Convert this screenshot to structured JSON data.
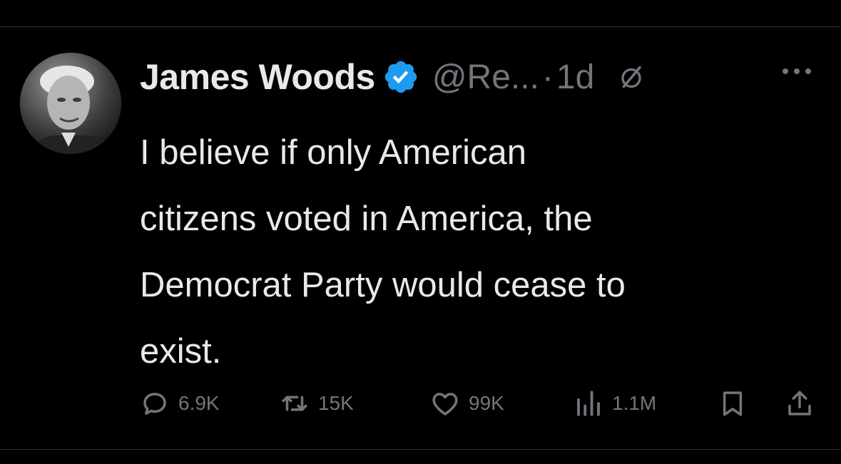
{
  "tweet": {
    "author_name": "James Woods",
    "handle": "@Re...",
    "separator": "·",
    "time": "1d",
    "verified": true,
    "verified_color": "#1d9bf0",
    "text_lines": [
      "I believe if only American",
      "citizens voted in America, the",
      "Democrat Party would cease to",
      "exist."
    ]
  },
  "actions": {
    "replies": "6.9K",
    "retweets": "15K",
    "likes": "99K",
    "views": "1.1M"
  },
  "icons": {
    "verified": "verified-badge-icon",
    "grok": "grok-icon",
    "more": "more-icon",
    "reply": "reply-icon",
    "retweet": "retweet-icon",
    "like": "heart-icon",
    "views": "views-icon",
    "bookmark": "bookmark-icon",
    "share": "share-icon"
  },
  "colors": {
    "background": "#000000",
    "text": "#e7e9ea",
    "secondary": "#71767b"
  }
}
